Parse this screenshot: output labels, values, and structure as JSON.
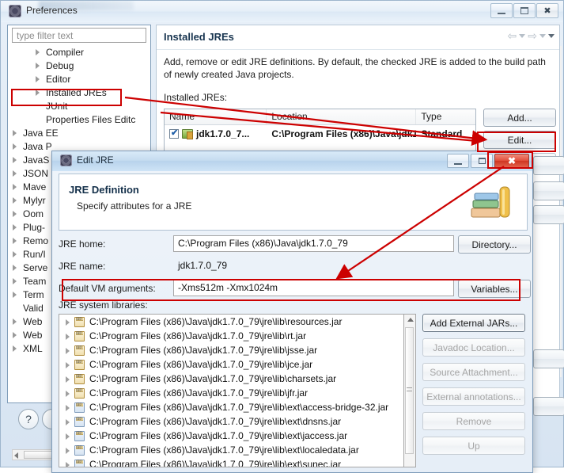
{
  "preferences": {
    "title": "Preferences",
    "window_buttons": {
      "minimize": "minimize-button",
      "maximize": "maximize-button",
      "close": "close-button"
    },
    "filter_placeholder": "type filter text",
    "tree": [
      {
        "label": "Compiler",
        "level": 2,
        "arrow": true
      },
      {
        "label": "Debug",
        "level": 2,
        "arrow": true
      },
      {
        "label": "Editor",
        "level": 2,
        "arrow": true
      },
      {
        "label": "Installed JREs",
        "level": 2,
        "arrow": true,
        "highlighted": true
      },
      {
        "label": "JUnit",
        "level": 2,
        "arrow": false
      },
      {
        "label": "Properties Files Editc",
        "level": 2,
        "arrow": false
      },
      {
        "label": "Java EE",
        "level": 1,
        "arrow": true
      },
      {
        "label": "Java P",
        "level": 1,
        "arrow": true
      },
      {
        "label": "JavaS",
        "level": 1,
        "arrow": true
      },
      {
        "label": "JSON",
        "level": 1,
        "arrow": true
      },
      {
        "label": "Mave",
        "level": 1,
        "arrow": true
      },
      {
        "label": "Mylyr",
        "level": 1,
        "arrow": true
      },
      {
        "label": "Oom",
        "level": 1,
        "arrow": true
      },
      {
        "label": "Plug-",
        "level": 1,
        "arrow": true
      },
      {
        "label": "Remo",
        "level": 1,
        "arrow": true
      },
      {
        "label": "Run/I",
        "level": 1,
        "arrow": true
      },
      {
        "label": "Serve",
        "level": 1,
        "arrow": true
      },
      {
        "label": "Team",
        "level": 1,
        "arrow": true
      },
      {
        "label": "Term",
        "level": 1,
        "arrow": true
      },
      {
        "label": "Valid",
        "level": 1,
        "arrow": false
      },
      {
        "label": "Web",
        "level": 1,
        "arrow": true
      },
      {
        "label": "Web",
        "level": 1,
        "arrow": true
      },
      {
        "label": "XML",
        "level": 1,
        "arrow": true
      }
    ],
    "help_button_label": "?",
    "content": {
      "title": "Installed JREs",
      "description": "Add, remove or edit JRE definitions. By default, the checked JRE is added to the build path of newly created Java projects.",
      "list_label": "Installed JREs:",
      "table": {
        "headers": [
          "Name",
          "Location",
          "Type"
        ],
        "rows": [
          {
            "checked": true,
            "name": "jdk1.7.0_7...",
            "location": "C:\\Program Files (x86)\\Java\\jdk1.7....",
            "type": "Standard"
          }
        ]
      },
      "buttons": {
        "add": "Add...",
        "edit": "Edit..."
      }
    }
  },
  "edit_jre_dialog": {
    "title": "Edit JRE",
    "header_title": "JRE Definition",
    "header_subtitle": "Specify attributes for a JRE",
    "fields": {
      "jre_home_label": "JRE home:",
      "jre_home_value": "C:\\Program Files (x86)\\Java\\jdk1.7.0_79",
      "jre_name_label": "JRE name:",
      "jre_name_value": "jdk1.7.0_79",
      "vm_args_label": "Default VM arguments:",
      "vm_args_value": "-Xms512m -Xmx1024m",
      "libraries_label": "JRE system libraries:"
    },
    "field_buttons": {
      "directory": "Directory...",
      "variables": "Variables..."
    },
    "libraries": [
      {
        "path": "C:\\Program Files (x86)\\Java\\jdk1.7.0_79\\jre\\lib\\resources.jar",
        "ext": false
      },
      {
        "path": "C:\\Program Files (x86)\\Java\\jdk1.7.0_79\\jre\\lib\\rt.jar",
        "ext": false
      },
      {
        "path": "C:\\Program Files (x86)\\Java\\jdk1.7.0_79\\jre\\lib\\jsse.jar",
        "ext": false
      },
      {
        "path": "C:\\Program Files (x86)\\Java\\jdk1.7.0_79\\jre\\lib\\jce.jar",
        "ext": false
      },
      {
        "path": "C:\\Program Files (x86)\\Java\\jdk1.7.0_79\\jre\\lib\\charsets.jar",
        "ext": false
      },
      {
        "path": "C:\\Program Files (x86)\\Java\\jdk1.7.0_79\\jre\\lib\\jfr.jar",
        "ext": false
      },
      {
        "path": "C:\\Program Files (x86)\\Java\\jdk1.7.0_79\\jre\\lib\\ext\\access-bridge-32.jar",
        "ext": true
      },
      {
        "path": "C:\\Program Files (x86)\\Java\\jdk1.7.0_79\\jre\\lib\\ext\\dnsns.jar",
        "ext": true
      },
      {
        "path": "C:\\Program Files (x86)\\Java\\jdk1.7.0_79\\jre\\lib\\ext\\jaccess.jar",
        "ext": true
      },
      {
        "path": "C:\\Program Files (x86)\\Java\\jdk1.7.0_79\\jre\\lib\\ext\\localedata.jar",
        "ext": true
      },
      {
        "path": "C:\\Program Files (x86)\\Java\\jdk1.7.0_79\\jre\\lib\\ext\\sunec.jar",
        "ext": true
      }
    ],
    "side_buttons": [
      {
        "label": "Add External JARs...",
        "disabled": false
      },
      {
        "label": "Javadoc Location...",
        "disabled": true
      },
      {
        "label": "Source Attachment...",
        "disabled": true
      },
      {
        "label": "External annotations...",
        "disabled": true
      },
      {
        "label": "Remove",
        "disabled": true
      },
      {
        "label": "Up",
        "disabled": true
      }
    ]
  },
  "annotations": {
    "highlight_color": "#cc0000",
    "boxes": [
      {
        "name": "installed-jres-tree-item"
      },
      {
        "name": "edit-button"
      },
      {
        "name": "default-vm-arguments-row"
      },
      {
        "name": "close-button-dialog"
      }
    ]
  }
}
